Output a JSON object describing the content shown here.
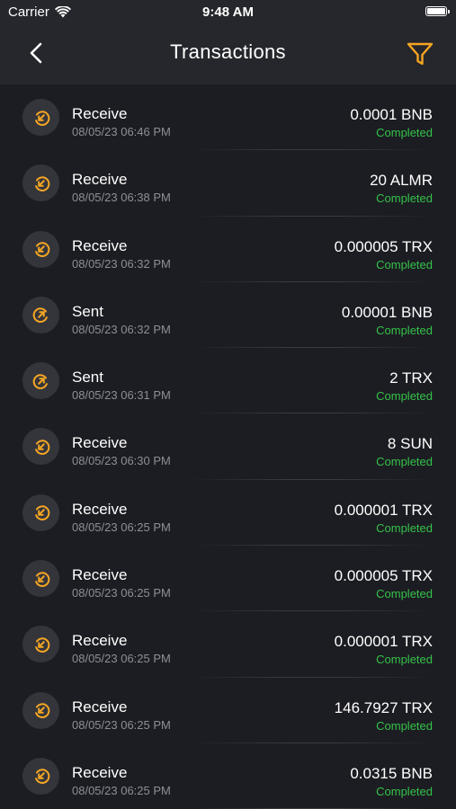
{
  "status_bar": {
    "carrier": "Carrier",
    "time": "9:48 AM"
  },
  "header": {
    "title": "Transactions",
    "back_icon": "chevron-left-icon",
    "filter_icon": "filter-icon"
  },
  "colors": {
    "accent": "#f5a623",
    "completed": "#34c24a",
    "background": "#1c1d22",
    "header_bg": "#26272c"
  },
  "transactions": [
    {
      "type": "Receive",
      "date": "08/05/23 06:46 PM",
      "amount": "0.0001 BNB",
      "status": "Completed",
      "icon": "receive-icon"
    },
    {
      "type": "Receive",
      "date": "08/05/23 06:38 PM",
      "amount": "20 ALMR",
      "status": "Completed",
      "icon": "receive-icon"
    },
    {
      "type": "Receive",
      "date": "08/05/23 06:32 PM",
      "amount": "0.000005 TRX",
      "status": "Completed",
      "icon": "receive-icon"
    },
    {
      "type": "Sent",
      "date": "08/05/23 06:32 PM",
      "amount": "0.00001 BNB",
      "status": "Completed",
      "icon": "sent-icon"
    },
    {
      "type": "Sent",
      "date": "08/05/23 06:31 PM",
      "amount": "2 TRX",
      "status": "Completed",
      "icon": "sent-icon"
    },
    {
      "type": "Receive",
      "date": "08/05/23 06:30 PM",
      "amount": "8 SUN",
      "status": "Completed",
      "icon": "receive-icon"
    },
    {
      "type": "Receive",
      "date": "08/05/23 06:25 PM",
      "amount": "0.000001 TRX",
      "status": "Completed",
      "icon": "receive-icon"
    },
    {
      "type": "Receive",
      "date": "08/05/23 06:25 PM",
      "amount": "0.000005 TRX",
      "status": "Completed",
      "icon": "receive-icon"
    },
    {
      "type": "Receive",
      "date": "08/05/23 06:25 PM",
      "amount": "0.000001 TRX",
      "status": "Completed",
      "icon": "receive-icon"
    },
    {
      "type": "Receive",
      "date": "08/05/23 06:25 PM",
      "amount": "146.7927 TRX",
      "status": "Completed",
      "icon": "receive-icon"
    },
    {
      "type": "Receive",
      "date": "08/05/23 06:25 PM",
      "amount": "0.0315 BNB",
      "status": "Completed",
      "icon": "receive-icon"
    }
  ]
}
